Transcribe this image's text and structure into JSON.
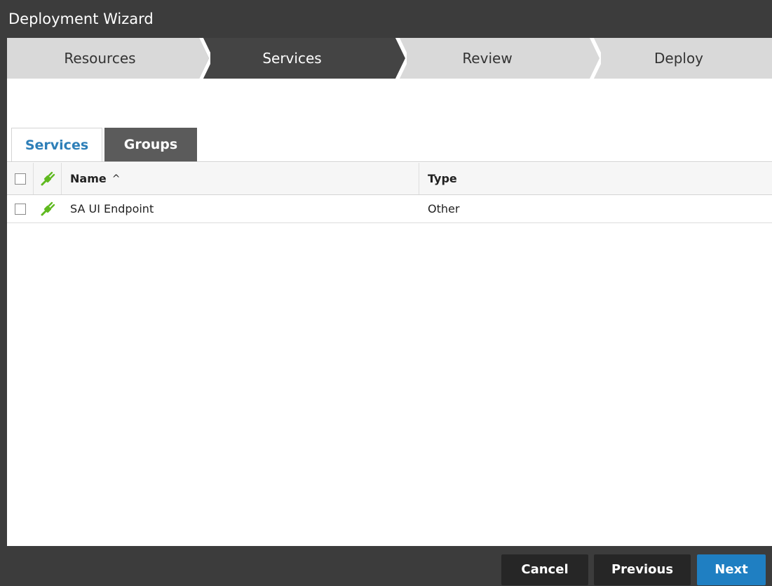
{
  "window": {
    "title": "Deployment Wizard"
  },
  "steps": [
    {
      "label": "Resources",
      "active": false
    },
    {
      "label": "Services",
      "active": true
    },
    {
      "label": "Review",
      "active": false
    },
    {
      "label": "Deploy",
      "active": false
    }
  ],
  "tabs": {
    "services_label": "Services",
    "groups_label": "Groups",
    "active": "Services"
  },
  "table": {
    "columns": {
      "name": "Name",
      "type": "Type"
    },
    "sort": {
      "column": "Name",
      "direction": "ascending",
      "caret": "^"
    },
    "rows": [
      {
        "name": "SA UI Endpoint",
        "type": "Other",
        "checked": false,
        "icon": "plug-icon"
      }
    ]
  },
  "footer": {
    "cancel_label": "Cancel",
    "previous_label": "Previous",
    "next_label": "Next"
  },
  "colors": {
    "accent": "#2e7fb8",
    "next_button": "#1f7fc2",
    "plug_icon": "#5fb91f",
    "dark_chrome": "#3c3c3c"
  }
}
